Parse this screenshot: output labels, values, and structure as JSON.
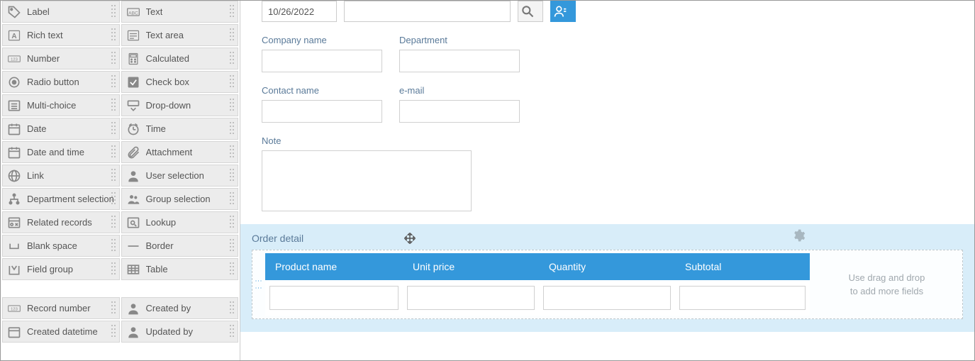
{
  "palette": {
    "rows": [
      [
        "Label",
        "Text"
      ],
      [
        "Rich text",
        "Text area"
      ],
      [
        "Number",
        "Calculated"
      ],
      [
        "Radio button",
        "Check box"
      ],
      [
        "Multi-choice",
        "Drop-down"
      ],
      [
        "Date",
        "Time"
      ],
      [
        "Date and time",
        "Attachment"
      ],
      [
        "Link",
        "User selection"
      ],
      [
        "Department selection",
        "Group selection"
      ],
      [
        "Related records",
        "Lookup"
      ],
      [
        "Blank space",
        "Border"
      ],
      [
        "Field group",
        "Table"
      ]
    ],
    "meta_rows": [
      [
        "Record number",
        "Created by"
      ],
      [
        "Created datetime",
        "Updated by"
      ]
    ]
  },
  "top": {
    "date_value": "10/26/2022"
  },
  "form": {
    "company_label": "Company name",
    "department_label": "Department",
    "contact_label": "Contact name",
    "email_label": "e-mail",
    "note_label": "Note"
  },
  "order": {
    "section_label": "Order detail",
    "columns": [
      "Product name",
      "Unit price",
      "Quantity",
      "Subtotal"
    ],
    "hint_line1": "Use drag and drop",
    "hint_line2": "to add more fields"
  }
}
